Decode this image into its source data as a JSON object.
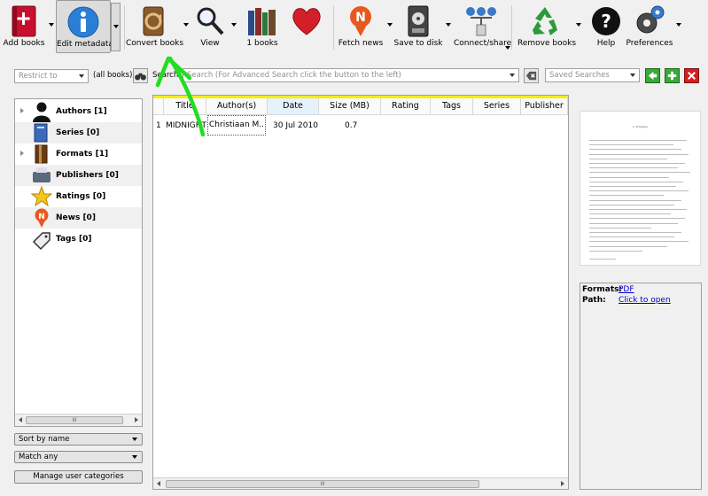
{
  "toolbar": {
    "add_books": "Add books",
    "edit_metadata": "Edit metadata",
    "convert_books": "Convert books",
    "view": "View",
    "library": "1 books",
    "fetch_news": "Fetch news",
    "save_to_disk": "Save to disk",
    "connect_share": "Connect/share",
    "remove_books": "Remove books",
    "help": "Help",
    "preferences": "Preferences"
  },
  "search": {
    "restrict_to": "Restrict to",
    "all_books": "(all books)",
    "search_label": "Search:",
    "placeholder": "Search (For Advanced Search click the button to the left)",
    "saved_searches": "Saved Searches"
  },
  "tag_browser": {
    "items": [
      {
        "label": "Authors [1]",
        "icon": "author-icon",
        "expandable": true
      },
      {
        "label": "Series [0]",
        "icon": "series-icon",
        "expandable": false
      },
      {
        "label": "Formats [1]",
        "icon": "formats-icon",
        "expandable": true
      },
      {
        "label": "Publishers [0]",
        "icon": "publishers-icon",
        "expandable": false
      },
      {
        "label": "Ratings [0]",
        "icon": "star-icon",
        "expandable": false
      },
      {
        "label": "News [0]",
        "icon": "news-icon",
        "expandable": false
      },
      {
        "label": "Tags [0]",
        "icon": "tag-icon",
        "expandable": false
      }
    ],
    "sort_by": "Sort by name",
    "match": "Match any",
    "manage": "Manage user categories",
    "scroll_mark": "III"
  },
  "book_list": {
    "columns": [
      "Title",
      "Author(s)",
      "Date",
      "Size (MB)",
      "Rating",
      "Tags",
      "Series",
      "Publisher"
    ],
    "rows": [
      {
        "num": "1",
        "title": "MIDNIGHT",
        "author": "Christiaan M...",
        "date": "30 Jul 2010",
        "size": "0.7",
        "rating": "",
        "tags": "",
        "series": "",
        "publisher": ""
      }
    ],
    "scroll_mark": "III"
  },
  "cover": {
    "heading": "1. Prologue"
  },
  "details": {
    "formats_label": "Formats:",
    "formats_value": "PDF",
    "path_label": "Path:",
    "path_value": "Click to open"
  },
  "colors": {
    "highlight": "#f2ee1a",
    "annotation_arrow": "#22dd22",
    "sorted_header": "#e6f2fb",
    "link": "#0000cc"
  }
}
